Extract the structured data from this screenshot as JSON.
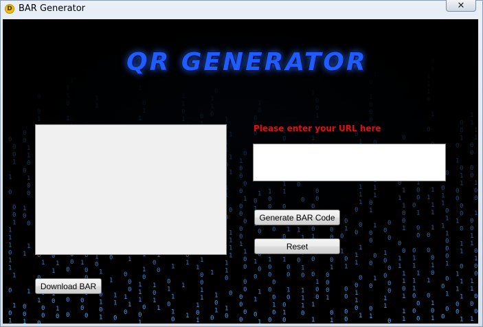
{
  "window": {
    "title": "BAR Generator",
    "app_icon": "D",
    "close_glyph": "✕"
  },
  "header": {
    "logo_text": "QR GENERATOR"
  },
  "form": {
    "url_label": "Please enter your URL here",
    "url_value": "",
    "generate_label": "Generate BAR Code",
    "reset_label": "Reset",
    "download_label": "Download BAR"
  },
  "colors": {
    "background": "#000000",
    "matrix_glyph": "#4aa8ff",
    "label_red": "#e01010",
    "logo_blue": "#1e5cff"
  }
}
